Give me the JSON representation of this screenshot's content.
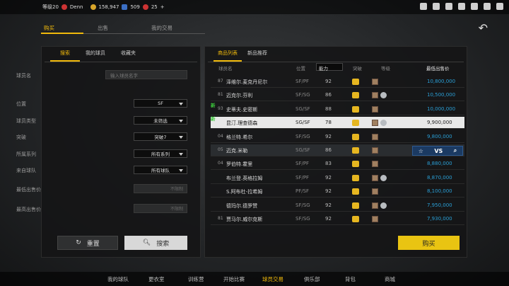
{
  "topbar": {
    "level": "等级20",
    "username": "Denn",
    "coins": "158,947",
    "vc": "509",
    "points": "25",
    "plus": "+"
  },
  "main_tabs": [
    "购买",
    "出售",
    "我的交易"
  ],
  "back_icon": "back-arrow-icon",
  "search_panel": {
    "tabs": [
      "搜索",
      "我的球员",
      "收藏夹"
    ],
    "name_label": "球员名",
    "name_placeholder": "输入球员名字",
    "fields": [
      {
        "label": "位置",
        "value": "SF"
      },
      {
        "label": "球员类型",
        "value": "未筛选"
      },
      {
        "label": "突破",
        "value": "突破7"
      },
      {
        "label": "所属系列",
        "value": "所有系列"
      },
      {
        "label": "来自球队",
        "value": "所有球队"
      }
    ],
    "min_price_label": "最低出售价",
    "min_price_placeholder": "不限制",
    "max_price_label": "最高出售价",
    "max_price_placeholder": "不限制",
    "reset_label": "重置",
    "search_label": "搜索"
  },
  "list_panel": {
    "tabs": [
      "商品列表",
      "新品推荐"
    ],
    "headers": {
      "player": "球员名",
      "position": "位置",
      "ability": "能力",
      "breakthrough": "突破",
      "tier": "等级",
      "lowest_price": "最低出售价"
    },
    "rows": [
      {
        "card": "87",
        "name": "泽维尔.麦克丹尼尔",
        "pos": "SF/PF",
        "ovr": "92",
        "price": "10,800,000"
      },
      {
        "card": "81",
        "name": "迈克尔.芬利",
        "pos": "SF/SG",
        "ovr": "86",
        "price": "10,500,000"
      },
      {
        "card": "93",
        "name": "史蒂夫.史密斯",
        "pos": "SG/SF",
        "ovr": "88",
        "price": "10,000,000",
        "new": "新"
      },
      {
        "card": "",
        "name": "昆汀.理查德森",
        "pos": "SG/SF",
        "ovr": "78",
        "price": "9,900,000",
        "new": "新"
      },
      {
        "card": "04",
        "name": "格兰特.希尔",
        "pos": "SF/SG",
        "ovr": "92",
        "price": "9,800,000"
      },
      {
        "card": "05",
        "name": "迈克.米勒",
        "pos": "SG/SF",
        "ovr": "86",
        "price": ""
      },
      {
        "card": "04",
        "name": "罗伯特.霍里",
        "pos": "SF/PF",
        "ovr": "83",
        "price": "8,880,000"
      },
      {
        "card": "",
        "name": "布兰登.英格拉姆",
        "pos": "SF/PF",
        "ovr": "92",
        "price": "8,870,000"
      },
      {
        "card": "",
        "name": "S.阿布杜-拉希姆",
        "pos": "PF/SF",
        "ovr": "92",
        "price": "8,100,000"
      },
      {
        "card": "",
        "name": "德玛尔.德罗赞",
        "pos": "SF/SG",
        "ovr": "92",
        "price": "7,950,000"
      },
      {
        "card": "81",
        "name": "贾马尔.威尔克斯",
        "pos": "SF/SG",
        "ovr": "92",
        "price": "7,930,000"
      }
    ],
    "vs_label": "VS",
    "buy_label": "购买"
  },
  "bottom_nav": [
    "我的球队",
    "更衣室",
    "训练营",
    "开始比赛",
    "球员交易",
    "俱乐部",
    "背包",
    "商城"
  ],
  "colors": {
    "accent": "#f0b90b",
    "price": "#2a9fd6",
    "buy": "#e9c412"
  }
}
